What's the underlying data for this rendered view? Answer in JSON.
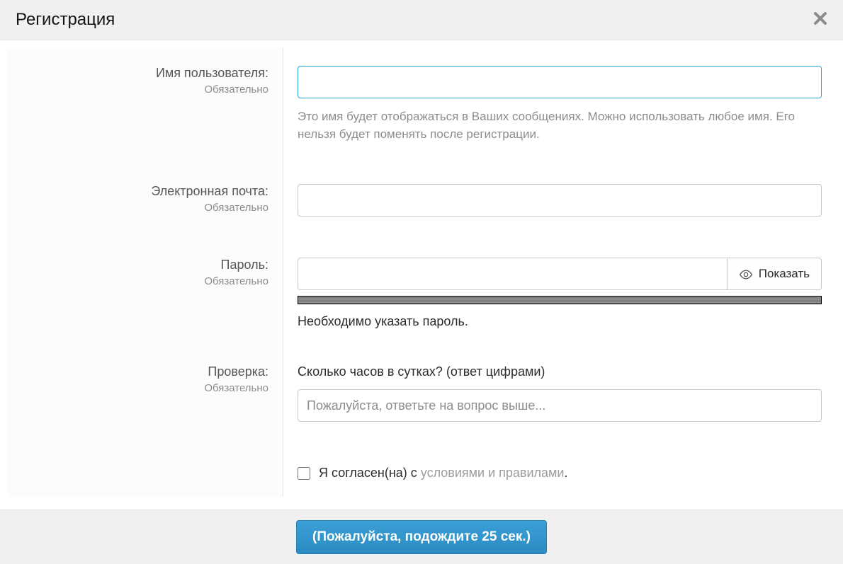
{
  "dialog": {
    "title": "Регистрация"
  },
  "fields": {
    "username": {
      "label": "Имя пользователя:",
      "required": "Обязательно",
      "value": "",
      "hint": "Это имя будет отображаться в Ваших сообщениях. Можно использовать любое имя. Его нельзя будет поменять после регистрации."
    },
    "email": {
      "label": "Электронная почта:",
      "required": "Обязательно",
      "value": ""
    },
    "password": {
      "label": "Пароль:",
      "required": "Обязательно",
      "value": "",
      "toggle": "Показать",
      "message": "Необходимо указать пароль."
    },
    "captcha": {
      "label": "Проверка:",
      "required": "Обязательно",
      "question": "Сколько часов в сутках? (ответ цифрами)",
      "placeholder": "Пожалуйста, ответьте на вопрос выше...",
      "value": ""
    }
  },
  "terms": {
    "prefix": "Я согласен(на) с ",
    "link": "условиями и правилами",
    "suffix": ".",
    "checked": false
  },
  "submit": {
    "label": "(Пожалуйста, подождите 25 сек.)"
  }
}
